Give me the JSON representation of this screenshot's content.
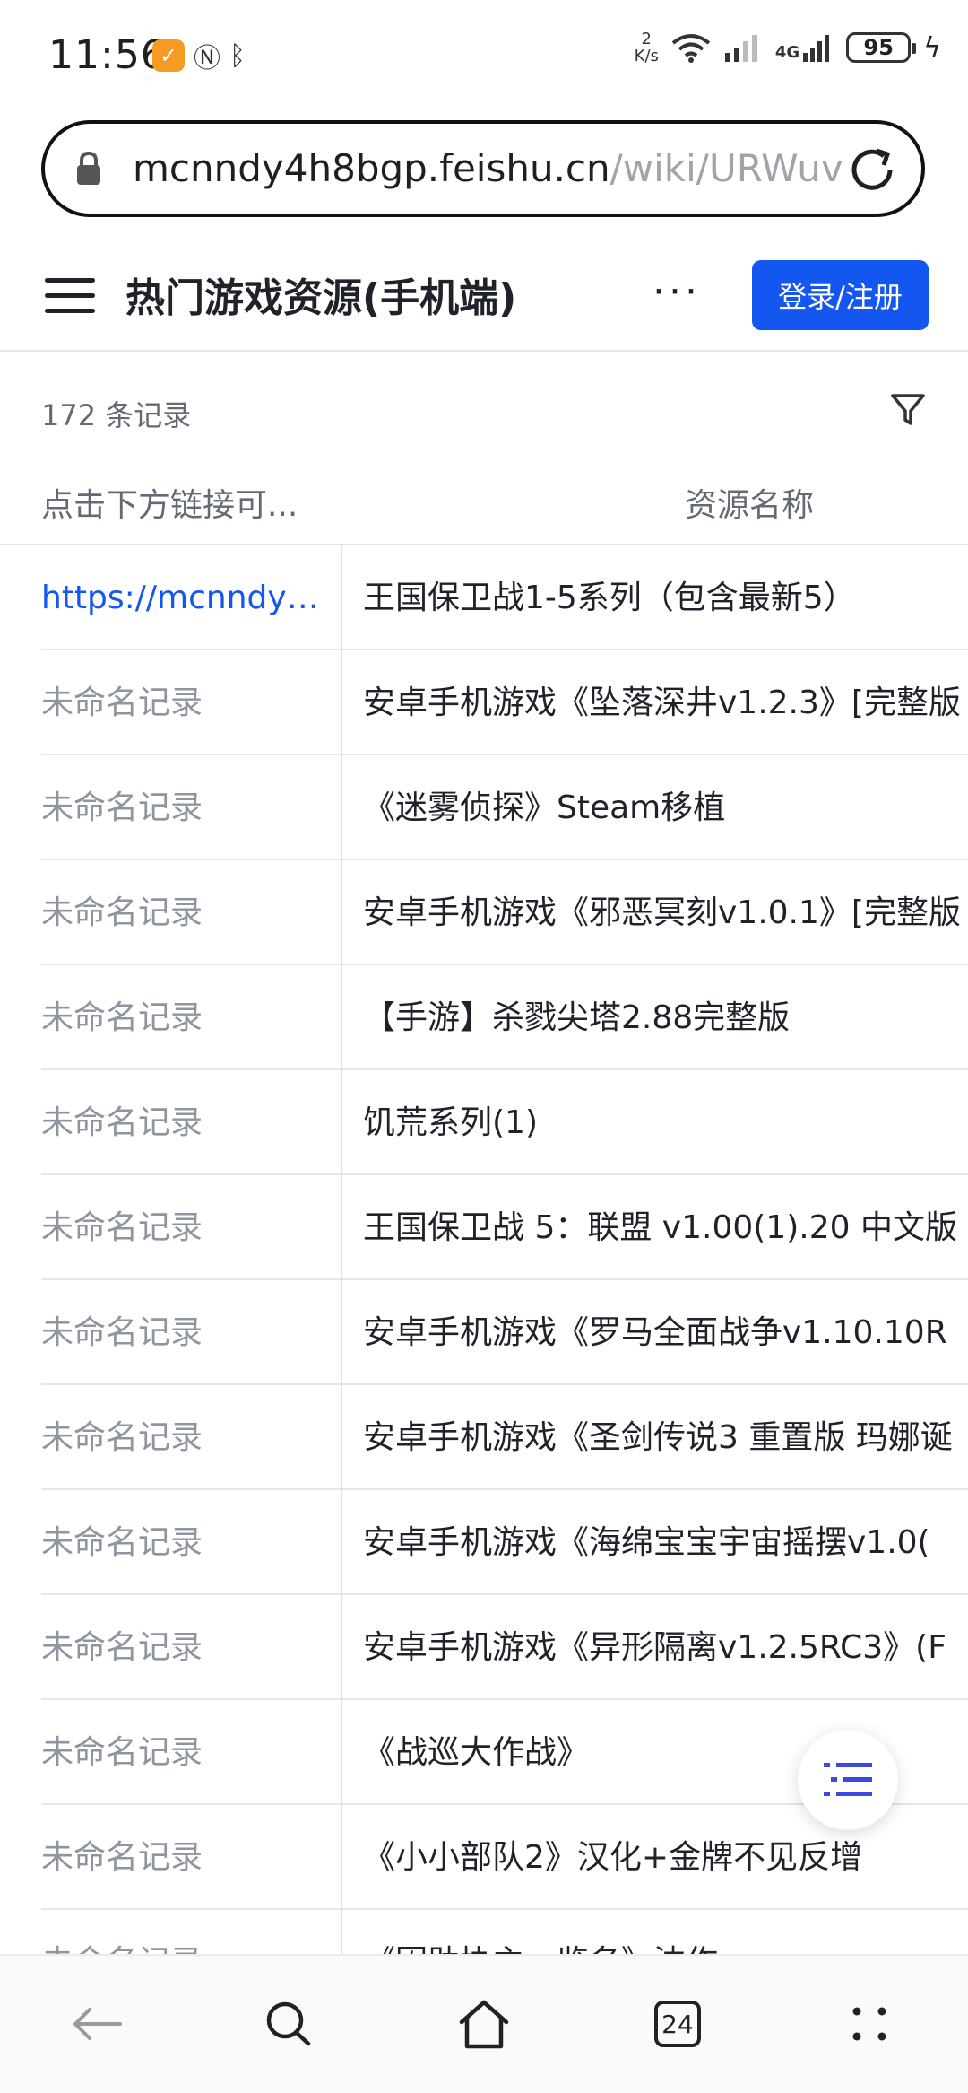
{
  "status": {
    "time": "11:56",
    "net_speed_value": "2",
    "net_speed_unit": "K/s",
    "network": "4G",
    "battery": "95"
  },
  "browser": {
    "url_host": "mcnndy4h8bgp.feishu.cn",
    "url_path": "/wiki/URWuv",
    "tab_count": "24"
  },
  "header": {
    "title": "热门游戏资源(手机端)",
    "more": "···",
    "login_label": "登录/注册"
  },
  "table": {
    "record_count": "172 条记录",
    "columns": [
      "点击下方链接可...",
      "资源名称"
    ],
    "rows": [
      {
        "c1": "https://mcnndy4...",
        "c2": "王国保卫战1-5系列（包含最新5）"
      },
      {
        "c1": "未命名记录",
        "c2": "安卓手机游戏《坠落深井v1.2.3》[完整版"
      },
      {
        "c1": "未命名记录",
        "c2": "《迷雾侦探》Steam移植"
      },
      {
        "c1": "未命名记录",
        "c2": "安卓手机游戏《邪恶冥刻v1.0.1》[完整版"
      },
      {
        "c1": "未命名记录",
        "c2": "【手游】杀戮尖塔2.88完整版"
      },
      {
        "c1": "未命名记录",
        "c2": "饥荒系列(1)"
      },
      {
        "c1": "未命名记录",
        "c2": "王国保卫战 5：联盟 v1.00(1).20 中文版"
      },
      {
        "c1": "未命名记录",
        "c2": "安卓手机游戏《罗马全面战争v1.10.10R"
      },
      {
        "c1": "未命名记录",
        "c2": "安卓手机游戏《圣剑传说3 重置版 玛娜诞"
      },
      {
        "c1": "未命名记录",
        "c2": "安卓手机游戏《海绵宝宝宇宙摇摆v1.0("
      },
      {
        "c1": "未命名记录",
        "c2": "安卓手机游戏《异形隔离v1.2.5RC3》(F"
      },
      {
        "c1": "未命名记录",
        "c2": "《战巡大作战》"
      },
      {
        "c1": "未命名记录",
        "c2": "《小小部队2》汉化+金牌不见反增"
      },
      {
        "c1": "未命名记录",
        "c2": "《因助协主一览名》沈作"
      }
    ]
  }
}
